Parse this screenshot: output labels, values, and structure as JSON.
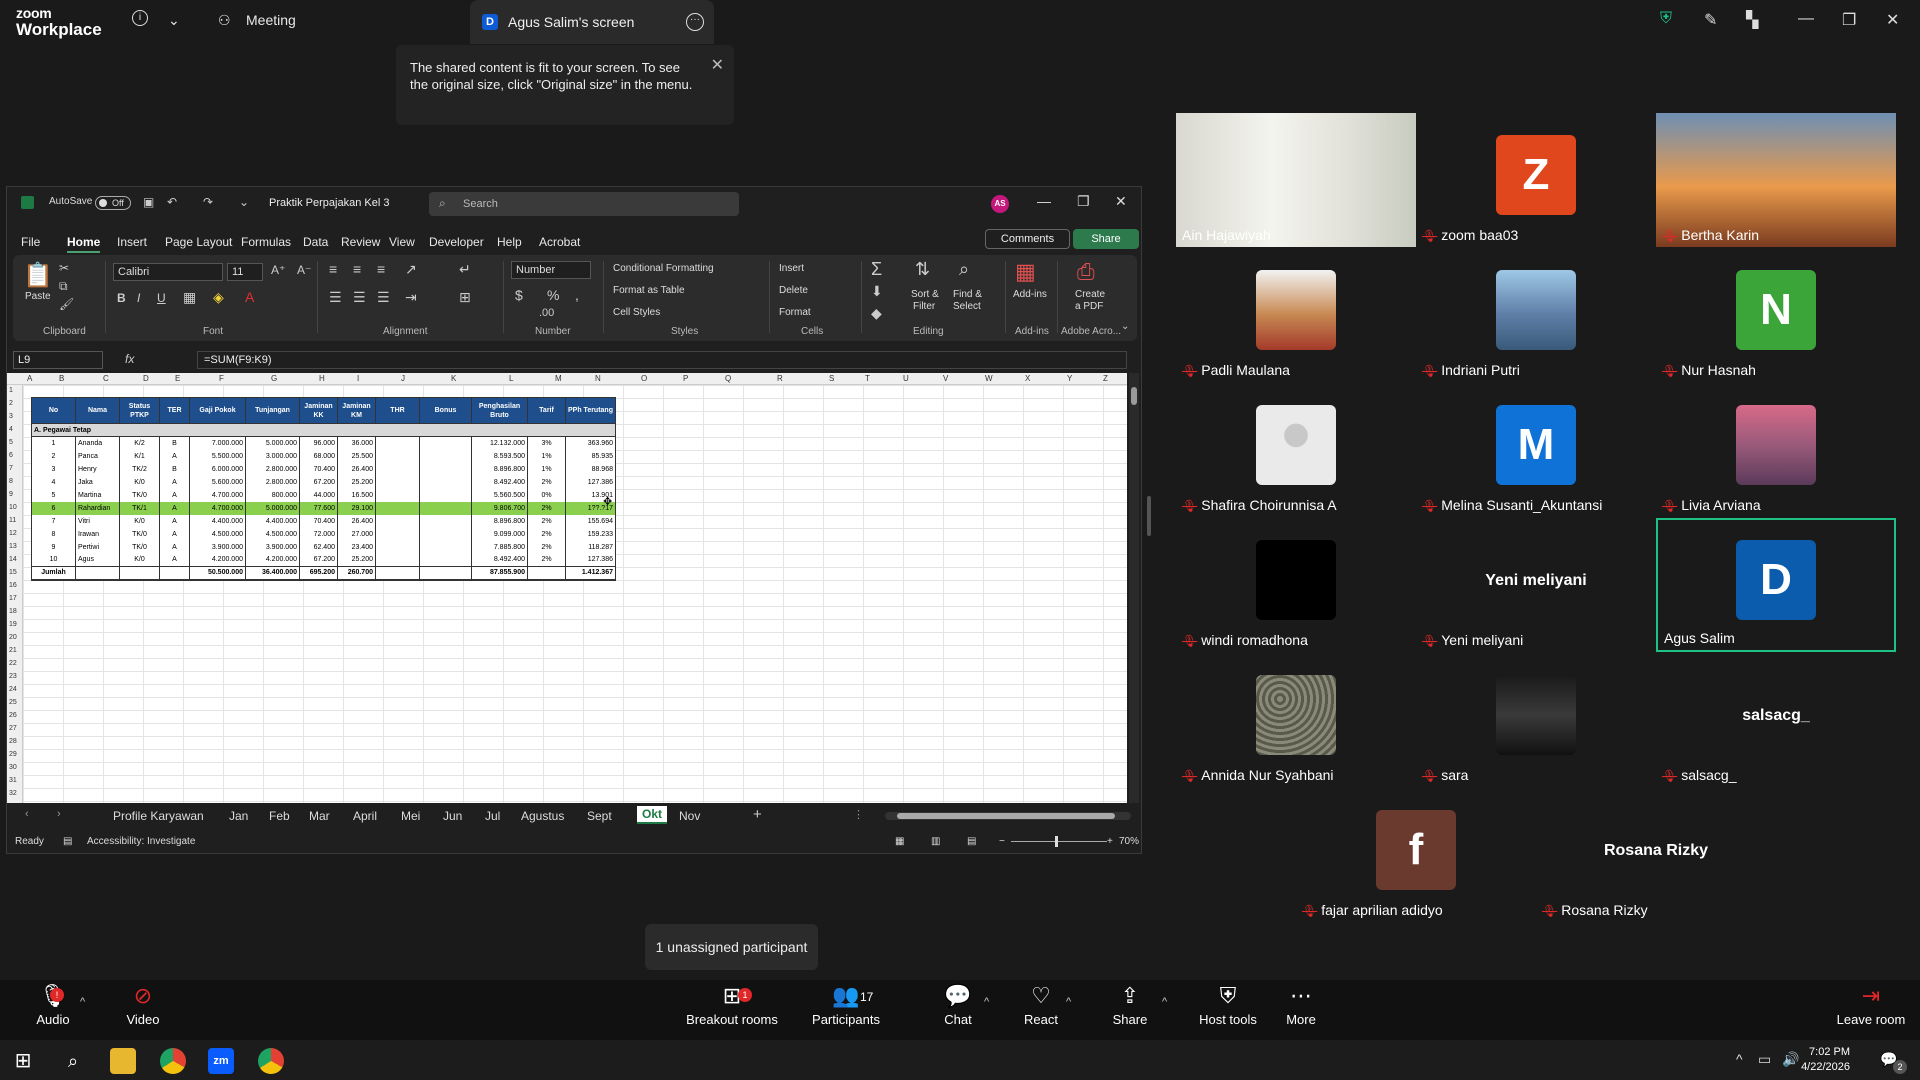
{
  "zoom": {
    "logo_line1": "zoom",
    "logo_line2": "Workplace",
    "meeting_label": "Meeting",
    "screen_badge": "D",
    "screen_tab_label": "Agus Salim's screen",
    "toast_text": "The shared content is fit to your screen. To see the original size, click \"Original size\" in the menu.",
    "unassigned_tooltip": "1 unassigned participant"
  },
  "excel": {
    "autosave_label": "AutoSave",
    "autosave_state": "Off",
    "doc_title": "Praktik Perpajakan Kel 3",
    "search_placeholder": "Search",
    "user_initials": "AS",
    "menu": [
      "File",
      "Home",
      "Insert",
      "Page Layout",
      "Formulas",
      "Data",
      "Review",
      "View",
      "Developer",
      "Help",
      "Acrobat"
    ],
    "comments_label": "Comments",
    "share_label": "Share",
    "ribbon": {
      "paste": "Paste",
      "font_name": "Calibri",
      "font_size": "11",
      "number_format": "Number",
      "conditional_formatting": "Conditional Formatting",
      "format_as_table": "Format as Table",
      "cell_styles": "Cell Styles",
      "insert": "Insert",
      "delete": "Delete",
      "format": "Format",
      "sort_filter_1": "Sort &",
      "sort_filter_2": "Filter",
      "find_select_1": "Find &",
      "find_select_2": "Select",
      "addins": "Add-ins",
      "create_pdf_1": "Create",
      "create_pdf_2": "a PDF",
      "groups": [
        "Clipboard",
        "Font",
        "Alignment",
        "Number",
        "Styles",
        "Cells",
        "Editing",
        "Add-ins",
        "Adobe Acro..."
      ]
    },
    "name_box": "L9",
    "formula": "=SUM(F9:K9)",
    "columns": [
      "A",
      "B",
      "C",
      "D",
      "E",
      "F",
      "G",
      "H",
      "I",
      "J",
      "K",
      "L",
      "M",
      "N",
      "O",
      "P",
      "Q",
      "R",
      "S",
      "T",
      "U",
      "V",
      "W",
      "X",
      "Y",
      "Z"
    ],
    "table_headers": [
      "No",
      "Nama",
      "Status PTKP",
      "TER",
      "Gaji Pokok",
      "Tunjangan",
      "Jaminan KK",
      "Jaminan KM",
      "THR",
      "Bonus",
      "Penghasilan Bruto",
      "Tarif",
      "PPh Terutang"
    ],
    "section_label": "A. Pegawai Tetap",
    "rows": [
      [
        "1",
        "Ananda",
        "K/2",
        "B",
        "7.000.000",
        "5.000.000",
        "96.000",
        "36.000",
        "",
        "",
        "12.132.000",
        "3%",
        "363.960"
      ],
      [
        "2",
        "Panca",
        "K/1",
        "A",
        "5.500.000",
        "3.000.000",
        "68.000",
        "25.500",
        "",
        "",
        "8.593.500",
        "1%",
        "85.935"
      ],
      [
        "3",
        "Henry",
        "TK/2",
        "B",
        "6.000.000",
        "2.800.000",
        "70.400",
        "26.400",
        "",
        "",
        "8.896.800",
        "1%",
        "88.968"
      ],
      [
        "4",
        "Jaka",
        "K/0",
        "A",
        "5.600.000",
        "2.800.000",
        "67.200",
        "25.200",
        "",
        "",
        "8.492.400",
        "2%",
        "127.386"
      ],
      [
        "5",
        "Martina",
        "TK/0",
        "A",
        "4.700.000",
        "800.000",
        "44.000",
        "16.500",
        "",
        "",
        "5.560.500",
        "0%",
        "13.901"
      ],
      [
        "6",
        "Rahardian",
        "TK/1",
        "A",
        "4.700.000",
        "5.000.000",
        "77.600",
        "29.100",
        "",
        "",
        "9.806.700",
        "2%",
        "1??.?17"
      ],
      [
        "7",
        "Vitri",
        "K/0",
        "A",
        "4.400.000",
        "4.400.000",
        "70.400",
        "26.400",
        "",
        "",
        "8.896.800",
        "2%",
        "155.694"
      ],
      [
        "8",
        "Irawan",
        "TK/0",
        "A",
        "4.500.000",
        "4.500.000",
        "72.000",
        "27.000",
        "",
        "",
        "9.099.000",
        "2%",
        "159.233"
      ],
      [
        "9",
        "Pertiwi",
        "TK/0",
        "A",
        "3.900.000",
        "3.900.000",
        "62.400",
        "23.400",
        "",
        "",
        "7.885.800",
        "2%",
        "118.287"
      ],
      [
        "10",
        "Agus",
        "K/0",
        "A",
        "4.200.000",
        "4.200.000",
        "67.200",
        "25.200",
        "",
        "",
        "8.492.400",
        "2%",
        "127.386"
      ]
    ],
    "total_row": [
      "Jumlah",
      "",
      "",
      "",
      "50.500.000",
      "36.400.000",
      "695.200",
      "260.700",
      "",
      "",
      "87.855.900",
      "",
      "1.412.367"
    ],
    "sheet_tabs": [
      "Profile Karyawan",
      "Jan",
      "Feb",
      "Mar",
      "April",
      "Mei",
      "Jun",
      "Jul",
      "Agustus",
      "Sept",
      "Okt",
      "Nov"
    ],
    "active_tab": "Okt",
    "status_ready": "Ready",
    "status_accessibility": "Accessibility: Investigate",
    "zoom_level": "70%"
  },
  "participants": [
    {
      "name": "Ain Hajawiyah",
      "muted": false,
      "kind": "video"
    },
    {
      "name": "zoom baa03",
      "muted": true,
      "kind": "letter",
      "letter": "Z",
      "color": "#e1471c"
    },
    {
      "name": "Bertha Karin",
      "muted": true,
      "kind": "photo"
    },
    {
      "name": "Padli Maulana",
      "muted": true,
      "kind": "photo"
    },
    {
      "name": "Indriani Putri",
      "muted": true,
      "kind": "photo"
    },
    {
      "name": "Nur Hasnah",
      "muted": true,
      "kind": "letter",
      "letter": "N",
      "color": "#3ba53a"
    },
    {
      "name": "Shafira Choirunnisa A",
      "muted": true,
      "kind": "photo"
    },
    {
      "name": "Melina Susanti_Akuntansi",
      "muted": true,
      "kind": "letter",
      "letter": "M",
      "color": "#0e72d6"
    },
    {
      "name": "Livia Arviana",
      "muted": true,
      "kind": "photo"
    },
    {
      "name": "windi romadhona",
      "muted": true,
      "kind": "photo"
    },
    {
      "name": "Yeni meliyani",
      "muted": true,
      "kind": "text"
    },
    {
      "name": "Agus Salim",
      "muted": false,
      "kind": "letter",
      "letter": "D",
      "color": "#0b5cad"
    },
    {
      "name": "Annida Nur Syahbani",
      "muted": true,
      "kind": "photo"
    },
    {
      "name": "sara",
      "muted": true,
      "kind": "photo"
    },
    {
      "name": "salsacg_",
      "muted": true,
      "kind": "text"
    },
    {
      "name": "fajar aprilian adidyo",
      "muted": true,
      "kind": "letter",
      "letter": "f",
      "color": "#6b3a2e"
    },
    {
      "name": "Rosana Rizky",
      "muted": true,
      "kind": "text"
    }
  ],
  "toolbar": {
    "audio": "Audio",
    "video": "Video",
    "breakout": "Breakout rooms",
    "breakout_badge": "1",
    "participants": "Participants",
    "participants_count": "17",
    "chat": "Chat",
    "react": "React",
    "share": "Share",
    "host_tools": "Host tools",
    "more": "More",
    "leave": "Leave room",
    "audio_badge": "!"
  },
  "taskbar": {
    "time": "7:02 PM",
    "date": "4/22/2026",
    "notif_count": "2"
  },
  "colors": {
    "accent_green": "#1fc285",
    "excel_green": "#1d7a45",
    "header_blue": "#1e4e8c",
    "highlight_row": "#8bcf4f",
    "mute_red": "#e02828"
  }
}
